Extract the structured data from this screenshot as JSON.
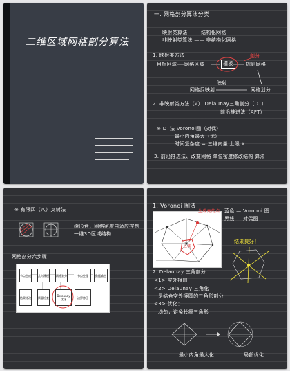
{
  "cover": {
    "title": "二维区域网格剖分算法"
  },
  "page2": {
    "heading": "一. 网格剖分算法分类",
    "line1": "映射类算法 —— 结构化网格",
    "line2": "非映射类算法 —— 非结构化网格",
    "sec1": "1. 映射类方法",
    "flow_left": "目标区域",
    "flow_mid": "网格区域",
    "flow_box": "模板",
    "flow_right": "规则网格",
    "flow_red": "剖分",
    "map_label": "映射",
    "flow_bottom_left": "网格反映射",
    "flow_bottom_right": "网格划分",
    "sec2": "2. 非映射类方法（√） Delaunay三角剖分（DT）",
    "sec2b": "前沿推进法（AFT）",
    "dt_line1": "※ DT法 Voronoi图（对偶）",
    "dt_line2": "最小内角最大（优）",
    "dt_line3": "时间复杂度 = 三维向量 上限 X",
    "sec3": "3. 前沿推进法、改变网格 单位密度修改结构 算法"
  },
  "page3": {
    "note1": "※ 有限四（八）叉树法",
    "note2": "树形合，网格密度自适应控制",
    "note3": "一维3D区域结构",
    "sec": "网格剖分六步骤",
    "nodes": [
      "节点生成",
      "几何建模",
      "网格划分",
      "节点处理",
      "数据输出",
      "结果修改",
      "质量检查",
      "Delaunay优化",
      "边界修正"
    ]
  },
  "page4": {
    "heading": "1. Voronoi 图法",
    "red_label": "生成元的点",
    "note_top1": "蓝色 — Voronoi 图",
    "note_top2": "黑线 — 对偶图",
    "yellow_note": "结果良好！",
    "sec2": "2. Delaunay 三角剖分",
    "li1": "<1> 空外接圆",
    "li2": "<2> Delaunay 三角化",
    "li3": "是结合空外接圆的三角形剖分",
    "li4": "<3> 优化：",
    "li5": "均匀，避免长瘦三角形",
    "bottom_left": "最小内角最大化",
    "bottom_right": "局部优化",
    "red_center": "区域"
  }
}
